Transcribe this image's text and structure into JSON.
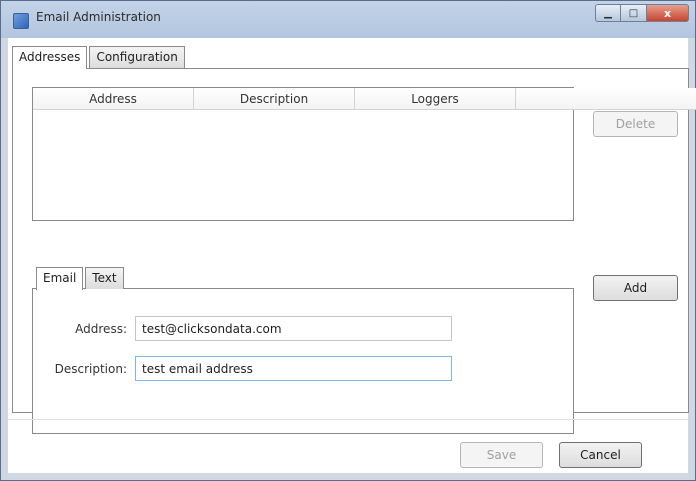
{
  "window": {
    "title": "Email Administration",
    "minimize_glyph": "▁",
    "maximize_glyph": "□",
    "close_glyph": "x"
  },
  "tabs": [
    {
      "label": "Addresses",
      "active": true
    },
    {
      "label": "Configuration",
      "active": false
    }
  ],
  "addresses_list": {
    "columns": [
      "Address",
      "Description",
      "Loggers"
    ],
    "rows": []
  },
  "inner_tabs": [
    {
      "label": "Email",
      "active": true
    },
    {
      "label": "Text",
      "active": false
    }
  ],
  "form": {
    "address_label": "Address:",
    "address_value": "test@clicksondata.com",
    "description_label": "Description:",
    "description_value": "test email address"
  },
  "buttons": {
    "delete": "Delete",
    "add": "Add",
    "save": "Save",
    "cancel": "Cancel"
  },
  "icons": {
    "app": "email-app-icon",
    "minimize": "minimize-icon",
    "maximize": "maximize-icon",
    "close": "close-icon"
  },
  "colors": {
    "titlebar": "#b9cbe2",
    "close_button": "#c7452e",
    "focus_border": "#7eb4ea",
    "disabled_text": "#a0a0a0"
  }
}
